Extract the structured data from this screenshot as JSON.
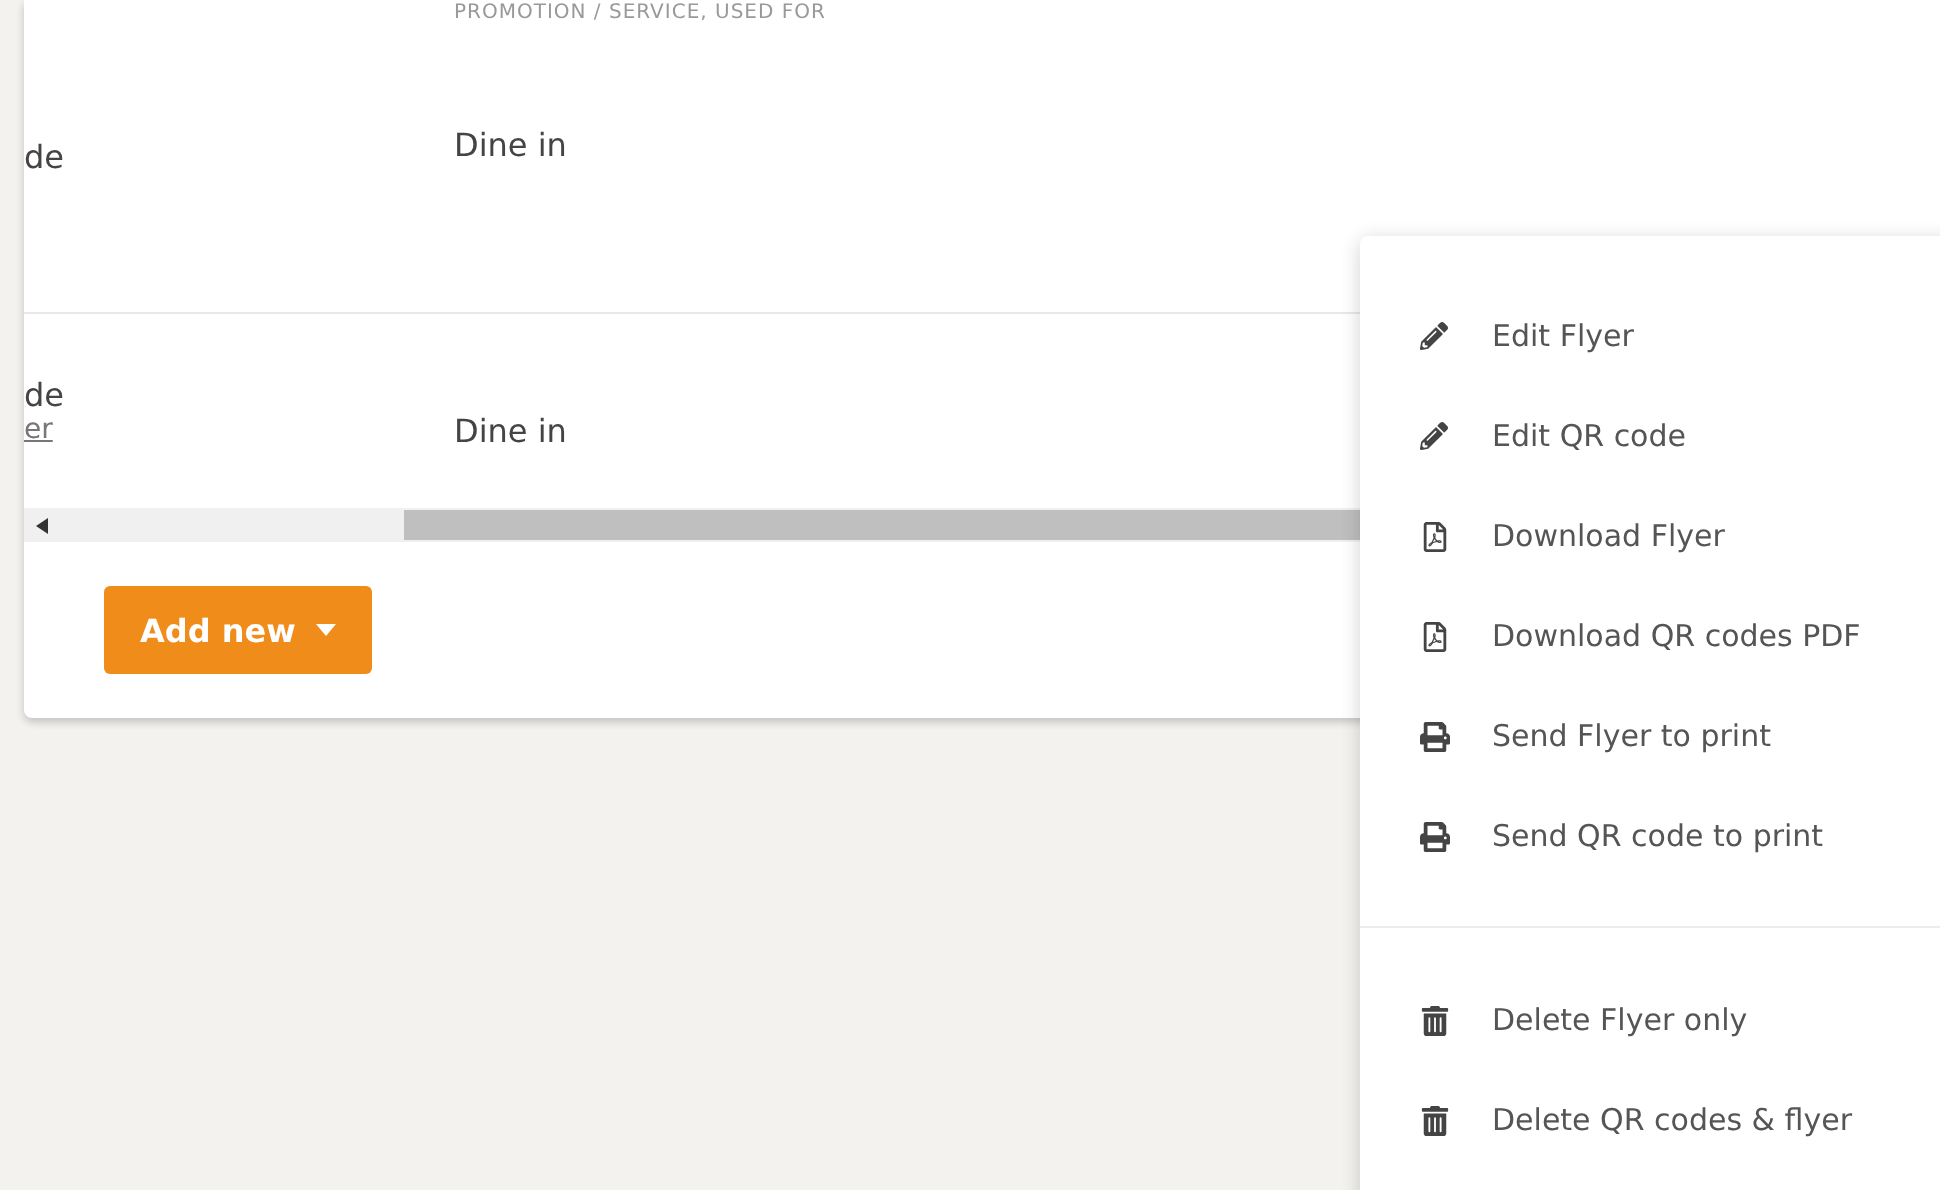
{
  "table": {
    "header_note": "PROMOTION / SERVICE, USED FOR",
    "rows": [
      {
        "column_1": "de",
        "column_2": "Dine in"
      },
      {
        "column_1": "de",
        "column_1_link": "er",
        "column_2": "Dine in"
      }
    ]
  },
  "footer": {
    "add_button": "Add new"
  },
  "menu": {
    "groups": [
      [
        {
          "kind": "edit",
          "label": "Edit Flyer"
        },
        {
          "kind": "edit",
          "label": "Edit QR code"
        },
        {
          "kind": "download",
          "label": "Download Flyer"
        },
        {
          "kind": "download",
          "label": "Download QR codes PDF"
        },
        {
          "kind": "print",
          "label": "Send Flyer to print"
        },
        {
          "kind": "print",
          "label": "Send QR code to print"
        }
      ],
      [
        {
          "kind": "delete",
          "label": "Delete Flyer only"
        },
        {
          "kind": "delete",
          "label": "Delete QR codes & flyer"
        }
      ]
    ]
  }
}
